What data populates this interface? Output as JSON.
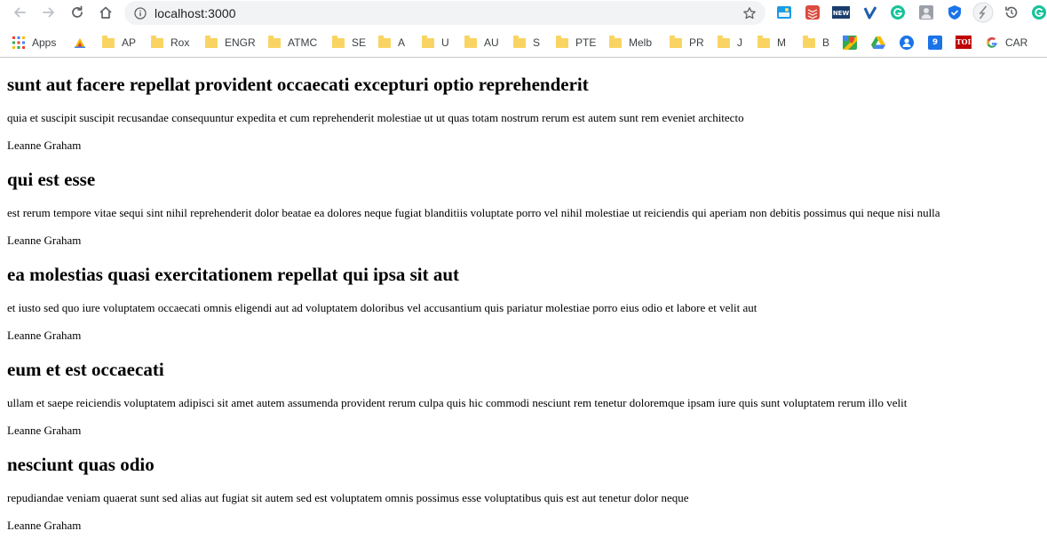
{
  "browser": {
    "address": "localhost:3000",
    "bookmarks": [
      {
        "label": "Apps",
        "kind": "apps"
      },
      {
        "label": "",
        "kind": "custom"
      },
      {
        "label": "AP",
        "kind": "folder"
      },
      {
        "label": "Rox",
        "kind": "folder"
      },
      {
        "label": "ENGR",
        "kind": "folder"
      },
      {
        "label": "ATMC",
        "kind": "folder"
      },
      {
        "label": "SE",
        "kind": "folder"
      },
      {
        "label": "A",
        "kind": "folder"
      },
      {
        "label": "U",
        "kind": "folder"
      },
      {
        "label": "AU",
        "kind": "folder"
      },
      {
        "label": "S",
        "kind": "folder"
      },
      {
        "label": "PTE",
        "kind": "folder"
      },
      {
        "label": "Melb",
        "kind": "folder"
      },
      {
        "label": "PR",
        "kind": "folder"
      },
      {
        "label": "J",
        "kind": "folder"
      },
      {
        "label": "M",
        "kind": "folder"
      },
      {
        "label": "B",
        "kind": "folder"
      },
      {
        "label": "",
        "kind": "maps"
      },
      {
        "label": "",
        "kind": "drive"
      },
      {
        "label": "",
        "kind": "account"
      },
      {
        "label": "",
        "kind": "calendar"
      },
      {
        "label": "TOI",
        "kind": "toi"
      },
      {
        "label": "CAR",
        "kind": "google"
      }
    ],
    "calendar_day": "9",
    "colors": {
      "folder": "#f9d462",
      "omnibox_bg": "#f1f3f4",
      "icon_gray": "#5f6368"
    }
  },
  "posts": [
    {
      "title": "sunt aut facere repellat provident occaecati excepturi optio reprehenderit",
      "body": "quia et suscipit suscipit recusandae consequuntur expedita et cum reprehenderit molestiae ut ut quas totam nostrum rerum est autem sunt rem eveniet architecto",
      "author": "Leanne Graham"
    },
    {
      "title": "qui est esse",
      "body": "est rerum tempore vitae sequi sint nihil reprehenderit dolor beatae ea dolores neque fugiat blanditiis voluptate porro vel nihil molestiae ut reiciendis qui aperiam non debitis possimus qui neque nisi nulla",
      "author": "Leanne Graham"
    },
    {
      "title": "ea molestias quasi exercitationem repellat qui ipsa sit aut",
      "body": "et iusto sed quo iure voluptatem occaecati omnis eligendi aut ad voluptatem doloribus vel accusantium quis pariatur molestiae porro eius odio et labore et velit aut",
      "author": "Leanne Graham"
    },
    {
      "title": "eum et est occaecati",
      "body": "ullam et saepe reiciendis voluptatem adipisci sit amet autem assumenda provident rerum culpa quis hic commodi nesciunt rem tenetur doloremque ipsam iure quis sunt voluptatem rerum illo velit",
      "author": "Leanne Graham"
    },
    {
      "title": "nesciunt quas odio",
      "body": "repudiandae veniam quaerat sunt sed alias aut fugiat sit autem sed est voluptatem omnis possimus esse voluptatibus quis est aut tenetur dolor neque",
      "author": "Leanne Graham"
    }
  ]
}
